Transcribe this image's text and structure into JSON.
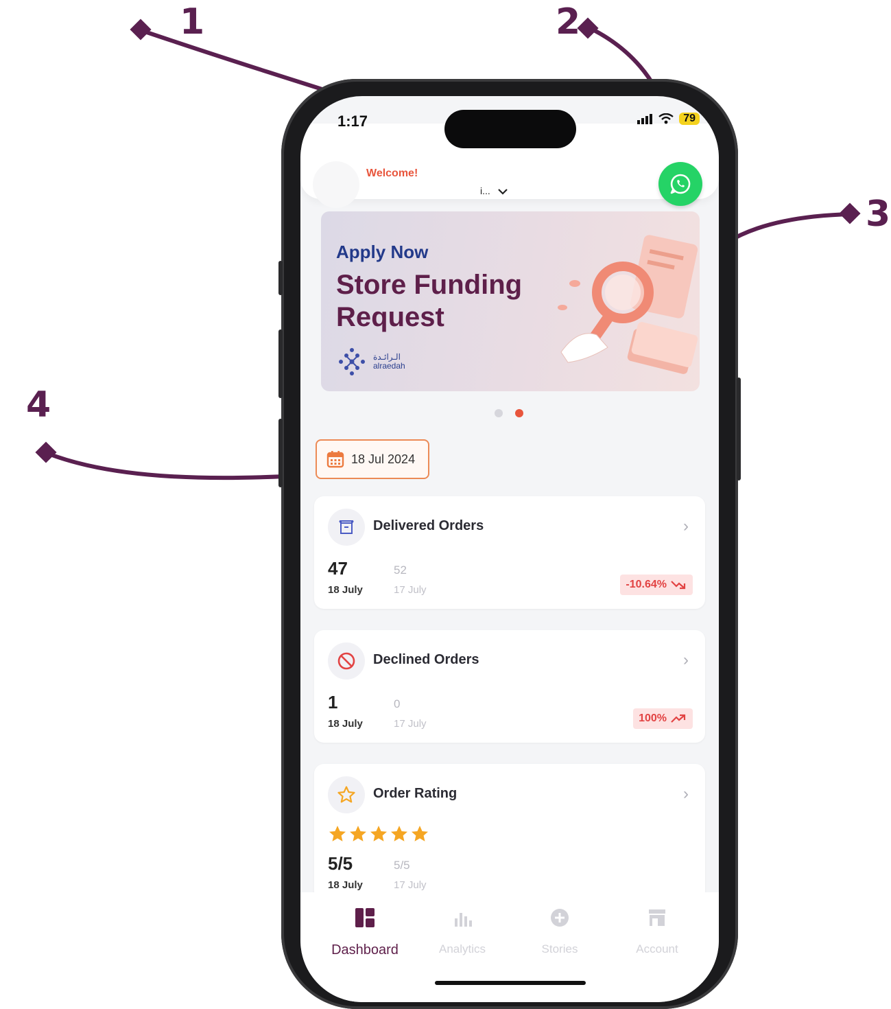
{
  "callouts": [
    "1",
    "2",
    "3",
    "4"
  ],
  "status_bar": {
    "time": "1:17",
    "battery": "79"
  },
  "header": {
    "welcome": "Welcome!",
    "store_name": "i..."
  },
  "banner": {
    "kicker": "Apply Now",
    "title": "Store Funding Request",
    "logo_arabic": "الـرائـدة",
    "logo_latin": "alraedah",
    "active_slide": 2,
    "slide_count": 2
  },
  "date_filter": {
    "value": "18 Jul 2024"
  },
  "cards": [
    {
      "title": "Delivered Orders",
      "icon": "box-icon",
      "today_value": "47",
      "today_label": "18 July",
      "prev_value": "52",
      "prev_label": "17 July",
      "change": "-10.64%",
      "trend": "down"
    },
    {
      "title": "Declined Orders",
      "icon": "ban-icon",
      "today_value": "1",
      "today_label": "18 July",
      "prev_value": "0",
      "prev_label": "17 July",
      "change": "100%",
      "trend": "up"
    },
    {
      "title": "Order Rating",
      "icon": "star-icon",
      "rating_stars": 5,
      "today_value": "5/5",
      "today_label": "18 July",
      "prev_value": "5/5",
      "prev_label": "17 July"
    }
  ],
  "tabs": [
    {
      "label": "Dashboard",
      "icon": "dashboard-icon",
      "active": true
    },
    {
      "label": "Analytics",
      "icon": "analytics-icon",
      "active": false
    },
    {
      "label": "Stories",
      "icon": "stories-icon",
      "active": false
    },
    {
      "label": "Account",
      "icon": "store-icon",
      "active": false
    }
  ],
  "colors": {
    "annotation": "#5a2050",
    "brand": "#5e1f4a",
    "accent": "#e8553c",
    "whatsapp": "#25d366",
    "star": "#f5a623"
  }
}
